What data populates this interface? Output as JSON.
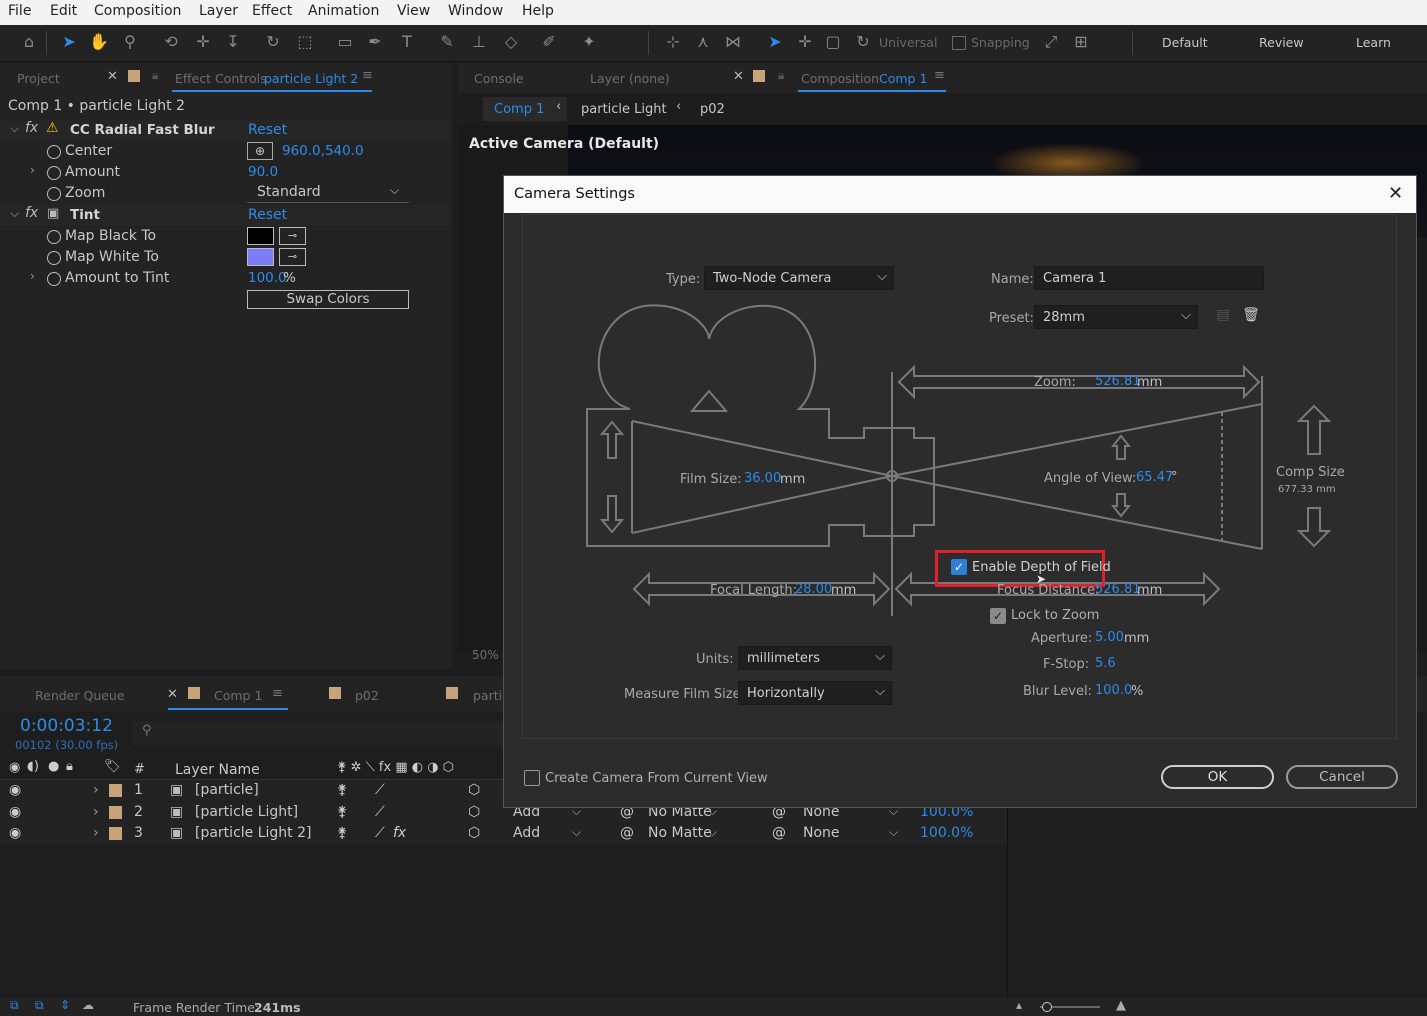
{
  "menu": [
    "File",
    "Edit",
    "Composition",
    "Layer",
    "Effect",
    "Animation",
    "View",
    "Window",
    "Help"
  ],
  "toolbar": {
    "universal": "Universal",
    "snapping": "Snapping",
    "workspaces": [
      "Default",
      "Review",
      "Learn"
    ]
  },
  "left_panel": {
    "tab_project": "Project",
    "tab_effect_controls": "Effect Controls",
    "tab_effect_layer": "particle Light 2",
    "breadcrumb": "Comp 1 • particle Light 2",
    "effects": [
      {
        "name": "CC Radial Fast Blur",
        "reset": "Reset"
      },
      {
        "name": "Tint",
        "reset": "Reset"
      }
    ],
    "props": {
      "center_label": "Center",
      "center_value": "960.0,540.0",
      "amount_label": "Amount",
      "amount_value": "90.0",
      "zoom_label": "Zoom",
      "zoom_value": "Standard",
      "map_black_label": "Map Black To",
      "map_black_color": "#000000",
      "map_white_label": "Map White To",
      "map_white_color": "#7b7cf6",
      "amount_tint_label": "Amount to Tint",
      "amount_tint_value": "100.0",
      "amount_tint_unit": "%",
      "swap_colors": "Swap Colors"
    }
  },
  "viewer": {
    "tab_console": "Console",
    "tab_layer": "Layer (none)",
    "tab_composition": "Composition",
    "tab_comp_name": "Comp 1",
    "crumbs": [
      "Comp 1",
      "particle Light",
      "p02"
    ],
    "active_camera": "Active Camera (Default)",
    "zoom": "50%"
  },
  "dialog": {
    "title": "Camera Settings",
    "type_label": "Type:",
    "type_value": "Two-Node Camera",
    "name_label": "Name:",
    "name_value": "Camera 1",
    "preset_label": "Preset:",
    "preset_value": "28mm",
    "zoom_label": "Zoom:",
    "zoom_value": "526.81",
    "zoom_unit": "mm",
    "film_size_label": "Film Size:",
    "film_size_value": "36.00",
    "film_size_unit": "mm",
    "angle_label": "Angle of View:",
    "angle_value": "65.47",
    "angle_unit": "°",
    "comp_size_label": "Comp Size",
    "comp_size_value": "677.33 mm",
    "enable_dof": "Enable Depth of Field",
    "focal_length_label": "Focal Length:",
    "focal_length_value": "28.00",
    "focal_length_unit": "mm",
    "focus_distance_label": "Focus Distance:",
    "focus_distance_value": "526.81",
    "focus_distance_unit": "mm",
    "lock_to_zoom": "Lock to Zoom",
    "aperture_label": "Aperture:",
    "aperture_value": "5.00",
    "aperture_unit": "mm",
    "fstop_label": "F-Stop:",
    "fstop_value": "5.6",
    "blur_label": "Blur Level:",
    "blur_value": "100.0",
    "blur_unit": "%",
    "units_label": "Units:",
    "units_value": "millimeters",
    "measure_label": "Measure Film Size:",
    "measure_value": "Horizontally",
    "create_from_view": "Create Camera From Current View",
    "ok": "OK",
    "cancel": "Cancel",
    "highlight_color": "#e0202a"
  },
  "timeline": {
    "tab_render_queue": "Render Queue",
    "tabs": [
      "Comp 1",
      "p02",
      "partic"
    ],
    "timecode": "0:00:03:12",
    "frame_info": "00102 (30.00 fps)",
    "col_number": "#",
    "col_layer_name": "Layer Name",
    "layers": [
      {
        "num": "1",
        "name": "[particle]",
        "mode": "",
        "matte": "",
        "parent": "",
        "opacity": ""
      },
      {
        "num": "2",
        "name": "[particle Light]",
        "mode": "Add",
        "matte": "No Matte",
        "parent": "None",
        "opacity": "100.0%"
      },
      {
        "num": "3",
        "name": "[particle Light 2]",
        "mode": "Add",
        "matte": "No Matte",
        "parent": "None",
        "opacity": "100.0%"
      }
    ],
    "frame_render_label": "Frame Render Time:",
    "frame_render_value": "241ms"
  }
}
